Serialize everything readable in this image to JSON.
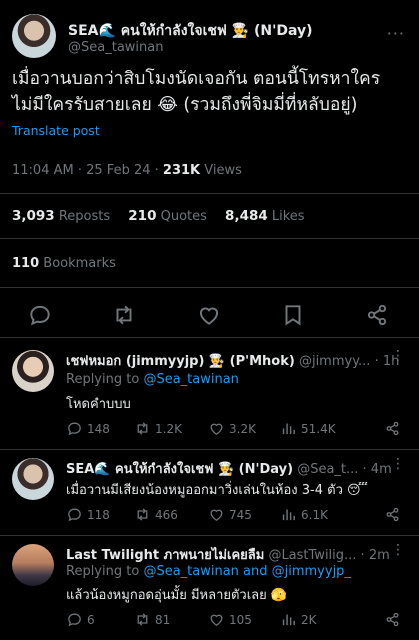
{
  "main_tweet": {
    "display_name": "SEA🌊 คนให้กำลังใจเชฟ 👨‍🍳 (N'Day)",
    "handle": "@Sea_tawinan",
    "text": "เมื่อวานบอกว่าสิบโมงนัดเจอกัน ตอนนี้โทรหาใครไม่มีใครรับสายเลย 😂 (รวมถึงพี่จิมมี่ที่หลับอยู่)",
    "translate_label": "Translate post",
    "time": "11:04 AM",
    "date": "25 Feb 24",
    "views_count": "231K",
    "views_label": "Views",
    "reposts_count": "3,093",
    "reposts_label": "Reposts",
    "quotes_count": "210",
    "quotes_label": "Quotes",
    "likes_count": "8,484",
    "likes_label": "Likes",
    "bookmarks_count": "110",
    "bookmarks_label": "Bookmarks"
  },
  "replies": [
    {
      "display_name": "เชฟหมอก (jimmyyjp) 👨‍🍳 (P'Mhok)",
      "handle_time": "@jimmyy... · 1h",
      "replying_prefix": "Replying to",
      "replying_to": "@Sea_tawinan",
      "text": "โหดคำบบบ",
      "replies": "148",
      "reposts": "1.2K",
      "likes": "3.2K",
      "views": "51.4K"
    },
    {
      "display_name": "SEA🌊 คนให้กำลังใจเชฟ 👨‍🍳 (N'Day)",
      "handle_time": "@Sea_t... · 4m",
      "text": "เมื่อวานมีเสียงน้องหมูออกมาวิ่งเล่นในห้อง 3-4 ตัว 😴",
      "replies": "118",
      "reposts": "466",
      "likes": "745",
      "views": "6.1K"
    },
    {
      "display_name": "Last Twilight ภาพนายไม่เคยลืม",
      "handle_time": "@LastTwilig... · 2m",
      "replying_prefix": "Replying to",
      "replying_to": "@Sea_tawinan and @jimmyyjp_",
      "text": "แล้วน้องหมูกอดอุ่นมั้ย มีหลายตัวเลย 🫣",
      "replies": "6",
      "reposts": "81",
      "likes": "105",
      "views": "2K"
    }
  ],
  "colors": {
    "background": "#000000",
    "text": "#e7e9ea",
    "muted": "#71767b",
    "accent": "#1d9bf0",
    "divider": "#2f3336"
  },
  "icons": [
    "reply-icon",
    "repost-icon",
    "like-icon",
    "bookmark-icon",
    "share-icon",
    "views-icon",
    "more-icon"
  ]
}
